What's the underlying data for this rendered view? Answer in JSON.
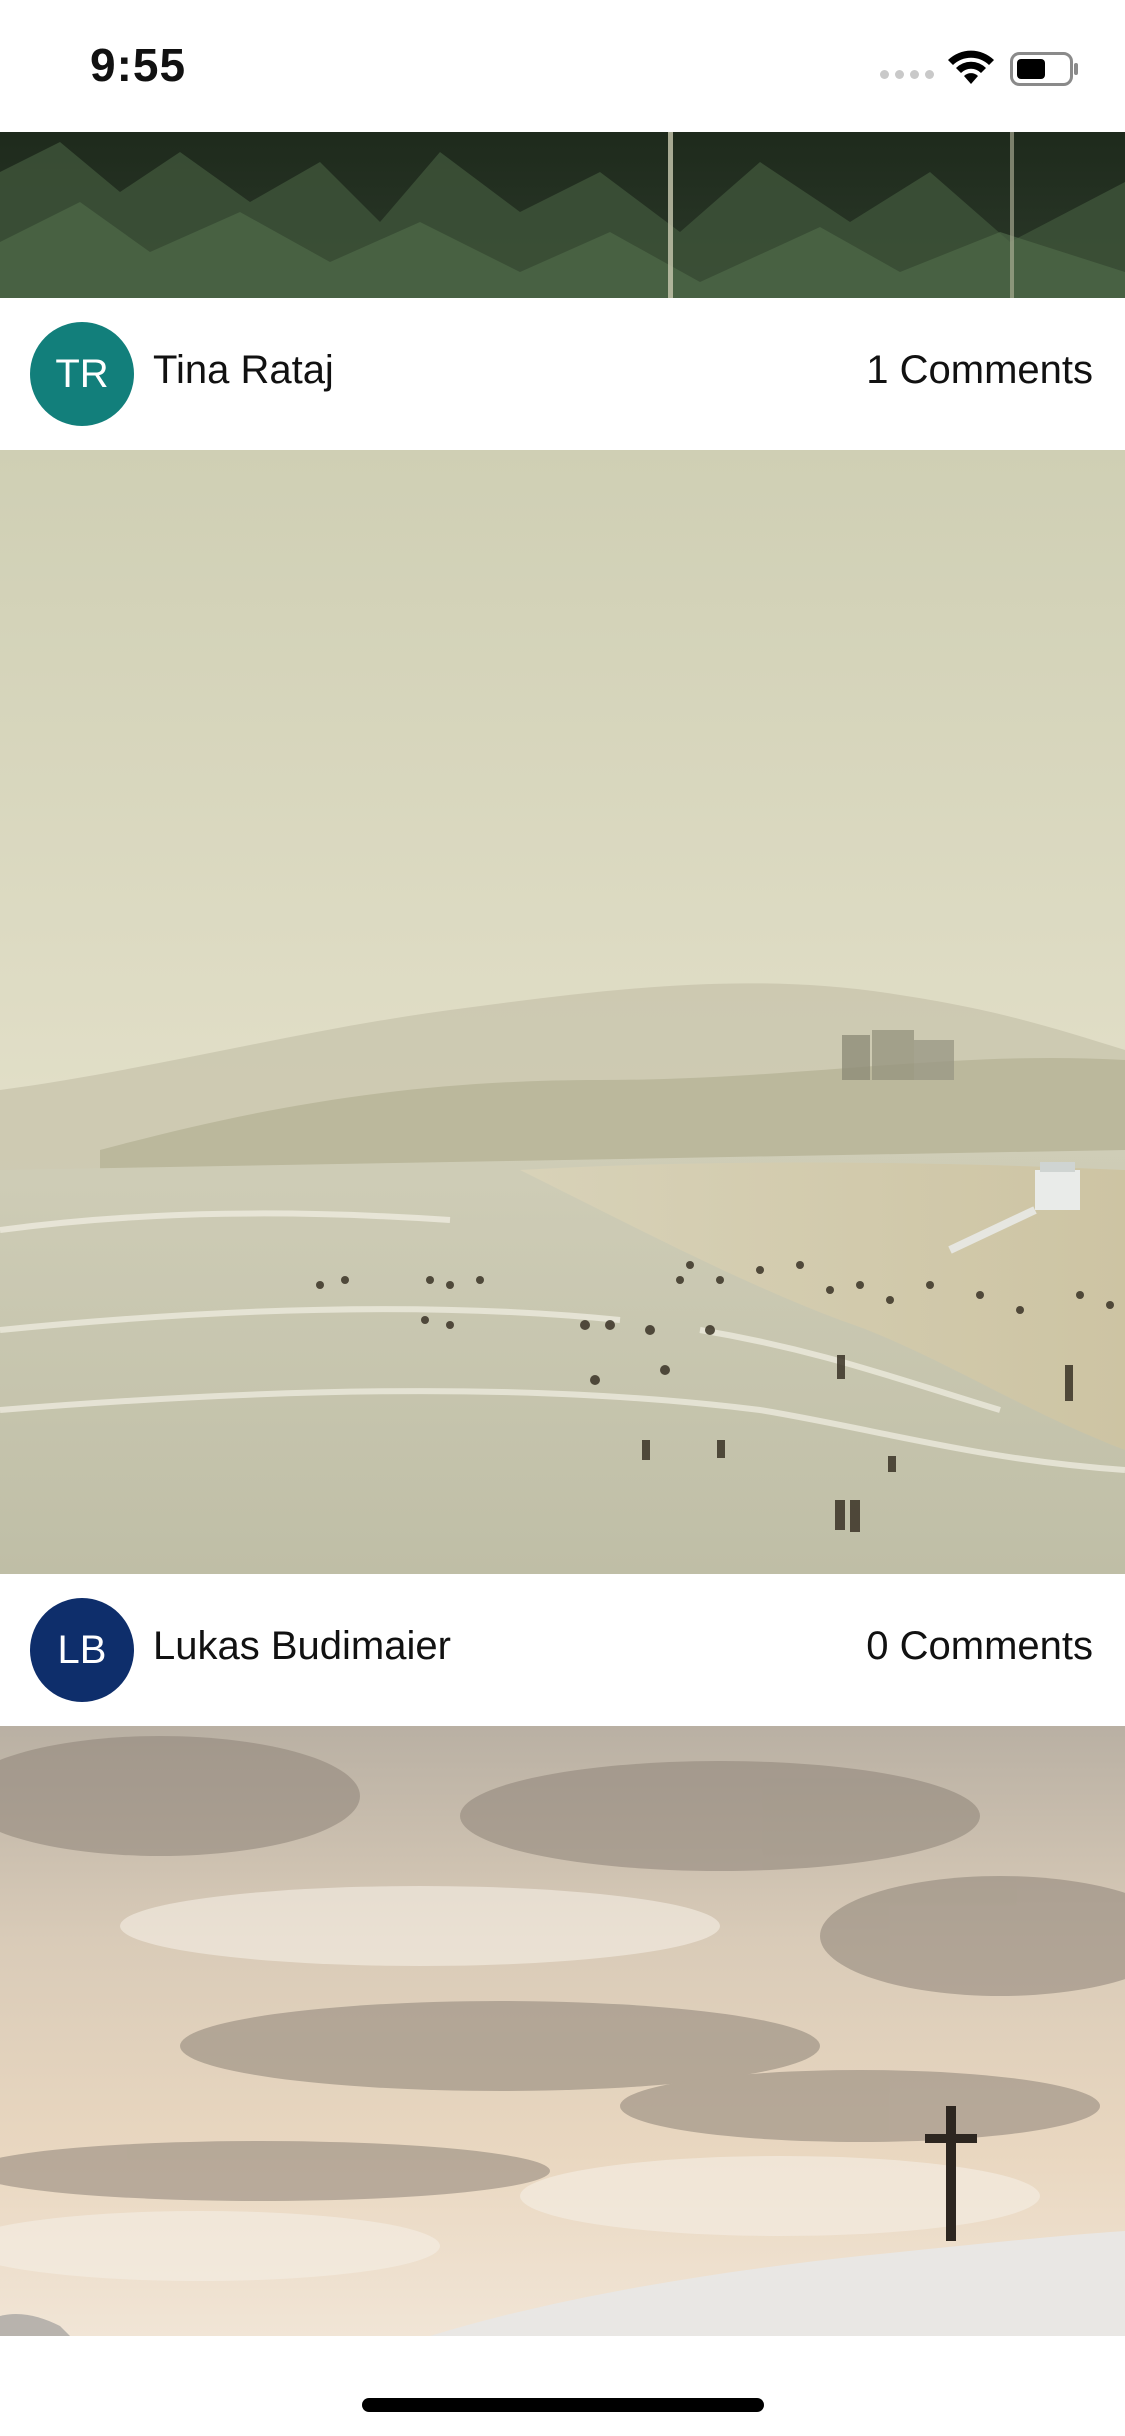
{
  "status_bar": {
    "time": "9:55",
    "icons": [
      "signal-dots-icon",
      "wifi-icon",
      "battery-icon"
    ]
  },
  "feed": {
    "posts": [
      {
        "author": "",
        "comments": "",
        "image": "forest-photo-top-cropped"
      },
      {
        "author": "Tina Rataj",
        "initials": "TR",
        "avatar_color": "#127f7b",
        "comments": "1 Comments",
        "image": "foggy-beach-with-swimmers"
      },
      {
        "author": "Lukas Budimaier",
        "initials": "LB",
        "avatar_color": "#0e2e6b",
        "comments": "0 Comments",
        "image": "cloudy-sky-with-cross-on-hill"
      }
    ]
  },
  "colors": {
    "background": "#ffffff",
    "text": "#111111"
  }
}
